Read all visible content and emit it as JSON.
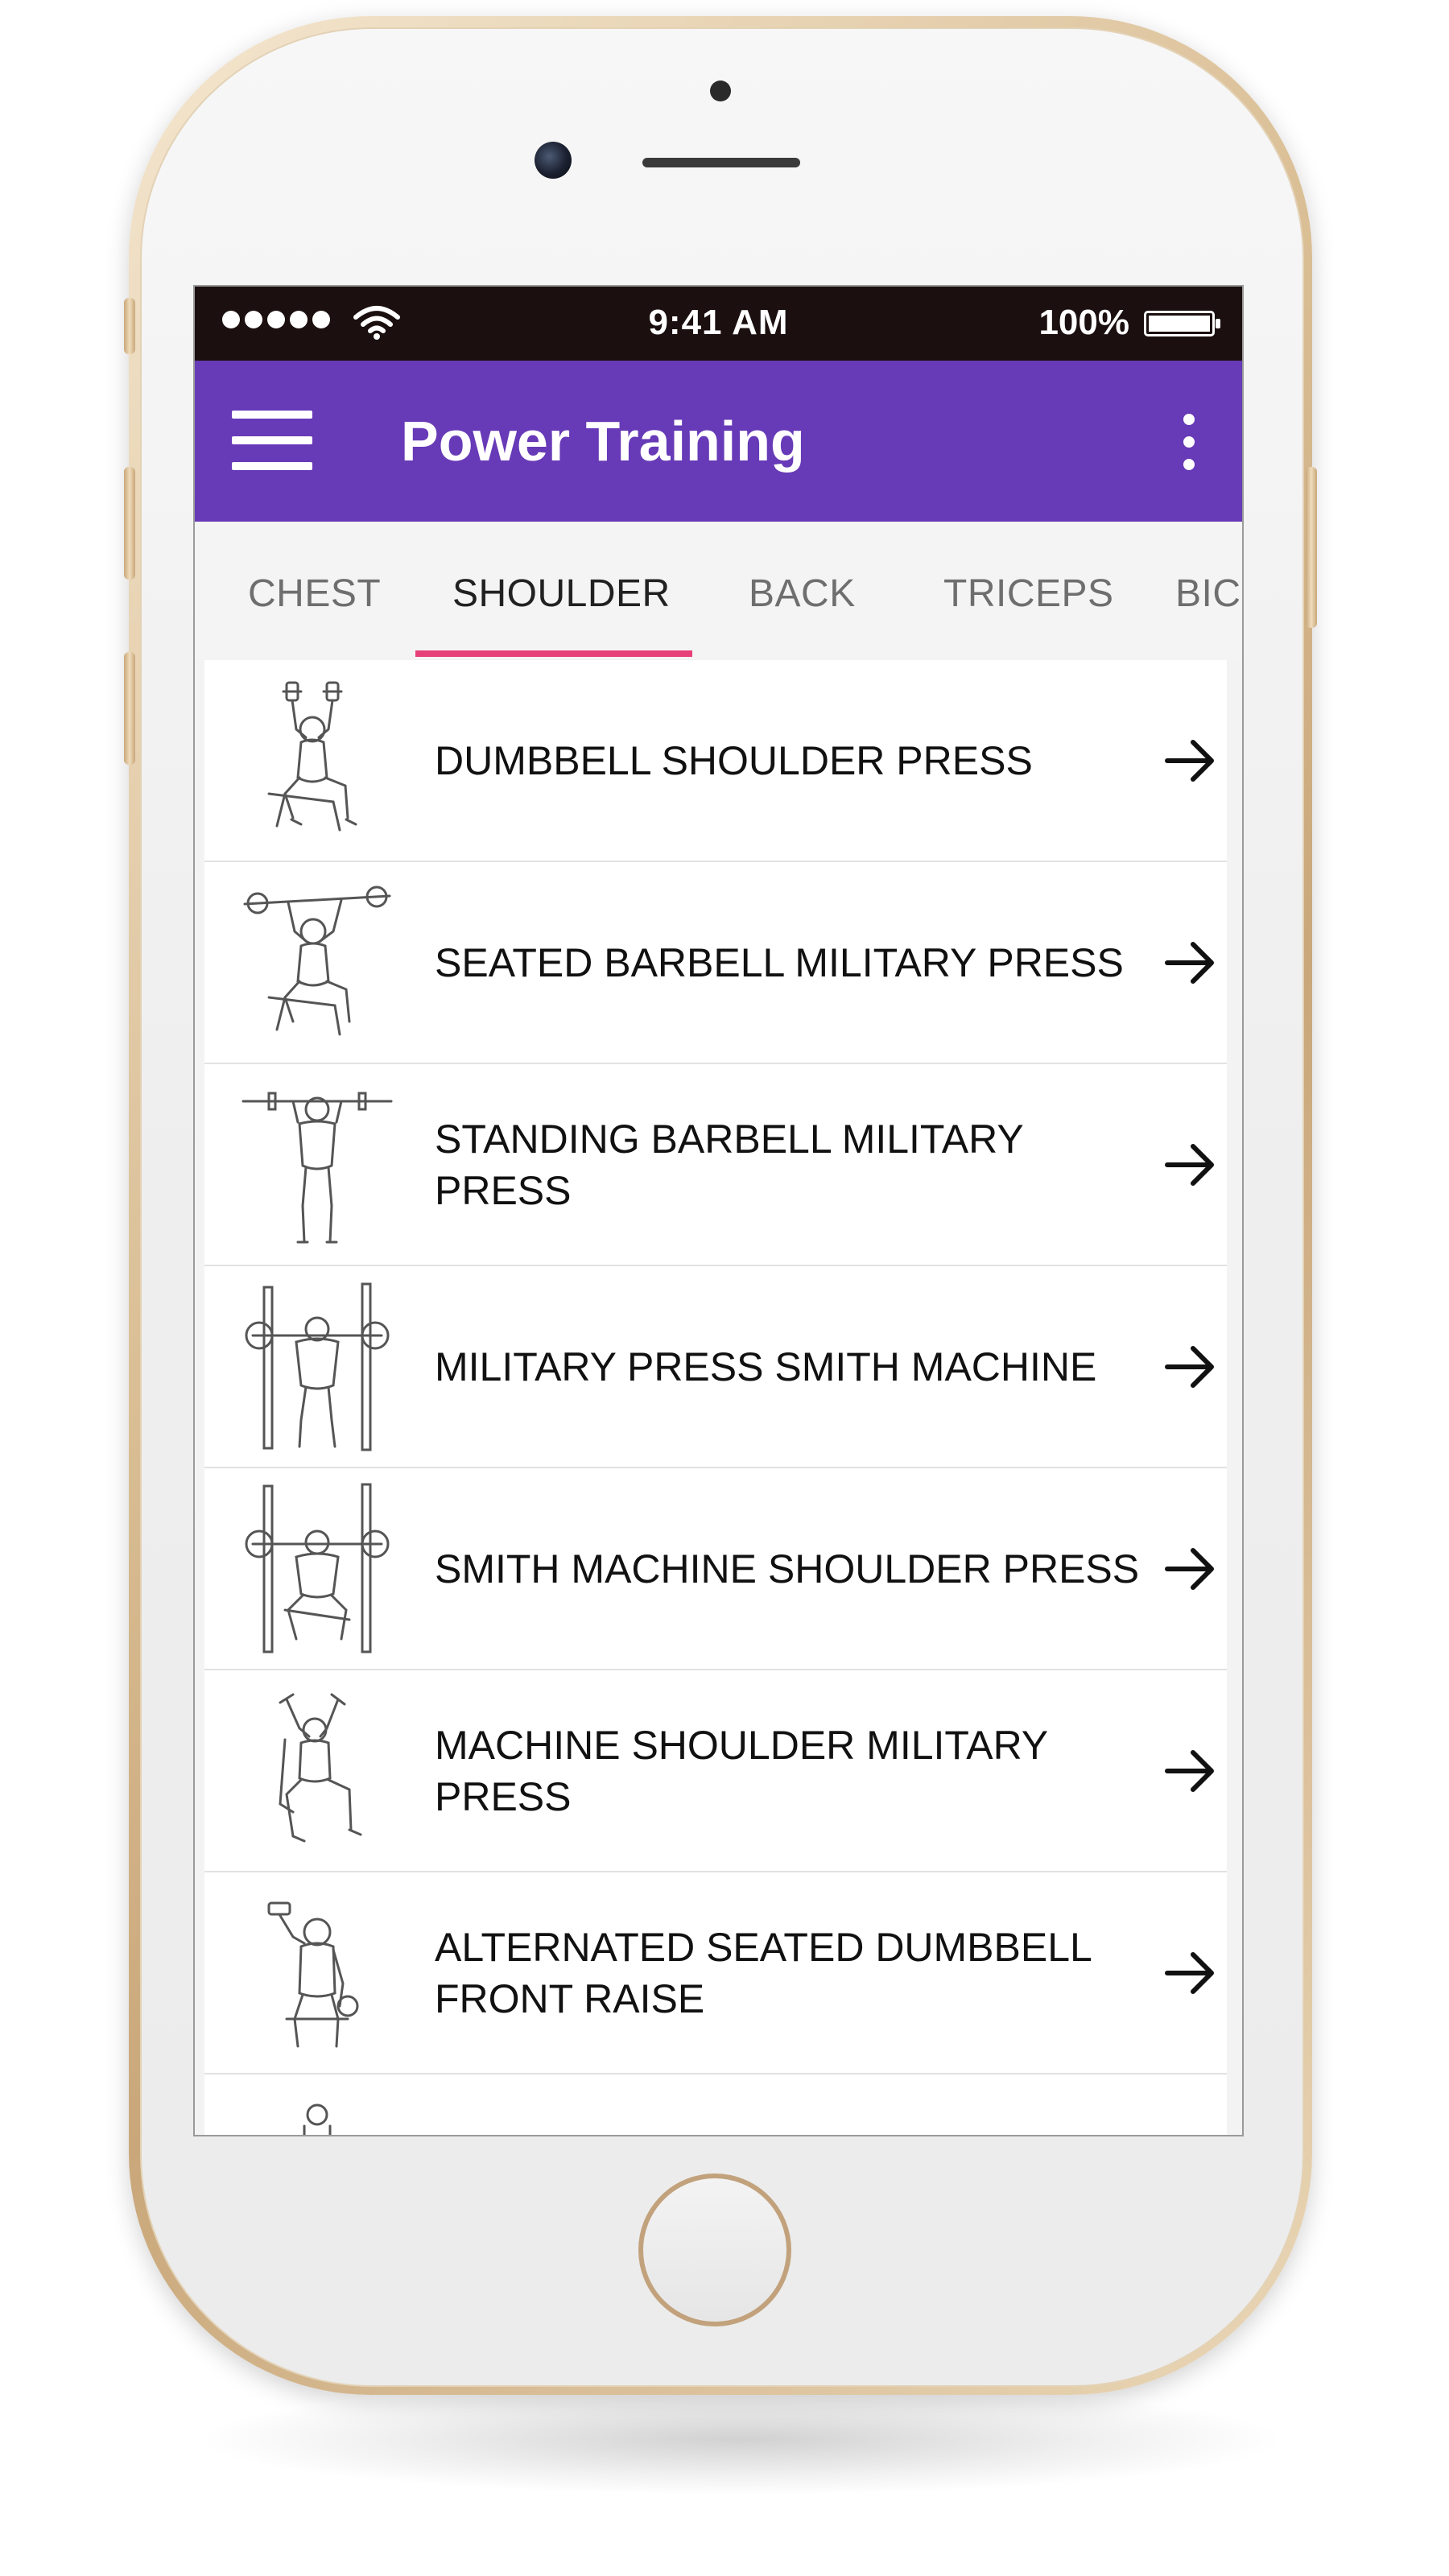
{
  "status_bar": {
    "time": "9:41 AM",
    "battery": "100%"
  },
  "app_bar": {
    "title": "Power Training",
    "menu_icon": "hamburger-menu-icon",
    "overflow_icon": "more-vertical-icon"
  },
  "tabs": [
    {
      "label": "CHEST",
      "active": false
    },
    {
      "label": "SHOULDER",
      "active": true
    },
    {
      "label": "BACK",
      "active": false
    },
    {
      "label": "TRICEPS",
      "active": false
    },
    {
      "label": "BIC",
      "active": false
    }
  ],
  "exercises": [
    {
      "label": "DUMBBELL SHOULDER PRESS",
      "thumb": "seated-dumbbell-press-figure"
    },
    {
      "label": "SEATED BARBELL MILITARY PRESS",
      "thumb": "seated-barbell-press-figure"
    },
    {
      "label": "STANDING BARBELL MILITARY PRESS",
      "thumb": "standing-barbell-press-figure"
    },
    {
      "label": "MILITARY PRESS SMITH MACHINE",
      "thumb": "smith-machine-standing-figure"
    },
    {
      "label": "SMITH MACHINE SHOULDER PRESS",
      "thumb": "smith-machine-seated-figure"
    },
    {
      "label": "MACHINE SHOULDER MILITARY PRESS",
      "thumb": "machine-press-figure"
    },
    {
      "label": "ALTERNATED SEATED DUMBBELL FRONT RAISE",
      "thumb": "seated-front-raise-figure"
    }
  ],
  "colors": {
    "app_bar": "#673ab7",
    "tab_indicator": "#e84079",
    "status_bar": "#1b0f0f"
  }
}
